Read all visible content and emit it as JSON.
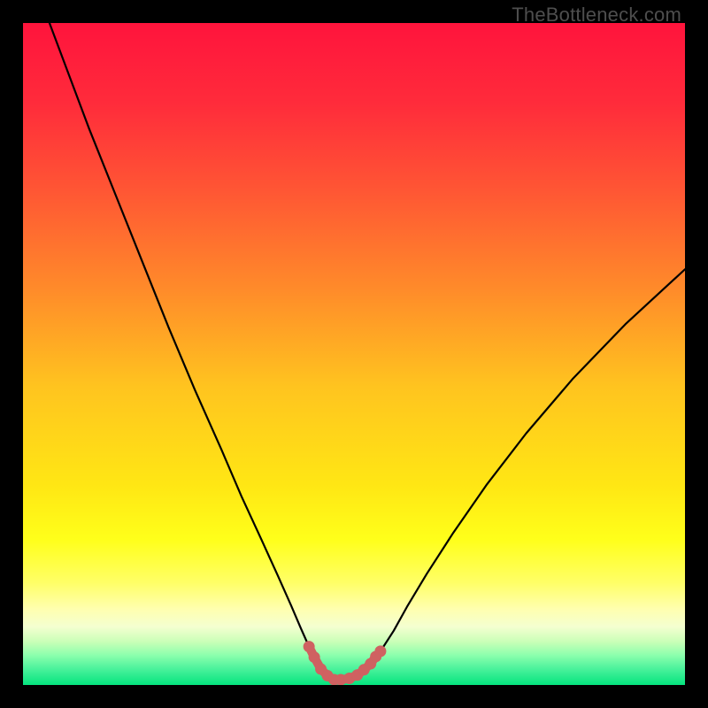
{
  "watermark": "TheBottleneck.com",
  "colors": {
    "frame": "#000000",
    "curve": "#000000",
    "marker_fill": "#cf6161",
    "marker_stroke": "#cf6161",
    "gradient_stops": [
      {
        "offset": 0.0,
        "color": "#ff143c"
      },
      {
        "offset": 0.12,
        "color": "#ff2b3b"
      },
      {
        "offset": 0.25,
        "color": "#ff5534"
      },
      {
        "offset": 0.4,
        "color": "#ff8a2a"
      },
      {
        "offset": 0.55,
        "color": "#ffc41f"
      },
      {
        "offset": 0.7,
        "color": "#ffe714"
      },
      {
        "offset": 0.78,
        "color": "#ffff1a"
      },
      {
        "offset": 0.845,
        "color": "#ffff66"
      },
      {
        "offset": 0.885,
        "color": "#ffffaf"
      },
      {
        "offset": 0.912,
        "color": "#f4ffd0"
      },
      {
        "offset": 0.935,
        "color": "#c9ffb7"
      },
      {
        "offset": 0.955,
        "color": "#8cffad"
      },
      {
        "offset": 0.975,
        "color": "#4cf29c"
      },
      {
        "offset": 1.0,
        "color": "#05e47e"
      }
    ]
  },
  "chart_data": {
    "type": "line",
    "title": "",
    "xlabel": "",
    "ylabel": "",
    "xlim": [
      0,
      100
    ],
    "ylim": [
      0,
      100
    ],
    "series": [
      {
        "name": "bottleneck-curve",
        "x": [
          4,
          7,
          10,
          14,
          18,
          22,
          26,
          30,
          33,
          36,
          38.5,
          40.5,
          42,
          43.2,
          44.2,
          45,
          46,
          47,
          48,
          49.5,
          51,
          52.5,
          54,
          56,
          58,
          61,
          65,
          70,
          76,
          83,
          91,
          100
        ],
        "y": [
          100,
          92,
          84,
          74,
          64,
          54,
          44.5,
          35.5,
          28.5,
          22,
          16.5,
          12,
          8.5,
          5.8,
          3.8,
          2.4,
          1.4,
          0.8,
          0.8,
          1.1,
          1.9,
          3.2,
          5.1,
          8.2,
          11.8,
          16.8,
          23,
          30.2,
          38,
          46.2,
          54.5,
          62.8
        ]
      }
    ],
    "markers": {
      "name": "optimal-region",
      "x": [
        43.2,
        44.0,
        45.0,
        46.0,
        47.0,
        48.0,
        49.3,
        50.5,
        51.5,
        52.5,
        53.3,
        54.0
      ],
      "y": [
        5.8,
        4.2,
        2.4,
        1.4,
        0.8,
        0.8,
        1.0,
        1.5,
        2.3,
        3.2,
        4.3,
        5.1
      ]
    }
  }
}
